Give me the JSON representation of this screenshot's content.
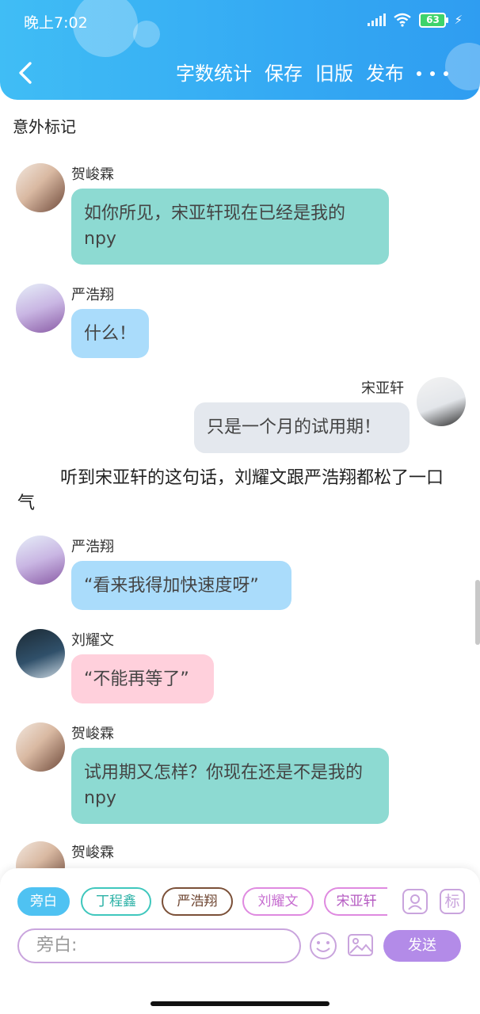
{
  "status": {
    "time": "晚上7:02",
    "battery": "63"
  },
  "nav": {
    "actions": [
      "字数统计",
      "保存",
      "旧版",
      "发布"
    ]
  },
  "doc": {
    "title": "意外标记"
  },
  "messages": [
    {
      "name": "贺峻霖",
      "text": "如你所见，宋亚轩现在已经是我的npy"
    },
    {
      "name": "严浩翔",
      "text": "什么！"
    },
    {
      "name": "宋亚轩",
      "text": "只是一个月的试用期！"
    },
    {
      "name": "严浩翔",
      "text": "“看来我得加快速度呀”"
    },
    {
      "name": "刘耀文",
      "text": "“不能再等了”"
    },
    {
      "name": "贺峻霖",
      "text": "试用期又怎样？你现在还是不是我的npy"
    },
    {
      "name": "贺峻霖",
      "text": ""
    }
  ],
  "narration": "听到宋亚轩的这句话，刘耀文跟严浩翔都松了一口气",
  "composer": {
    "roles": [
      "旁白",
      "丁程鑫",
      "严浩翔",
      "刘耀文",
      "宋亚轩"
    ],
    "mark_label": "标",
    "input_placeholder": "旁白:",
    "send_label": "发送"
  },
  "colors": {
    "header": "#35aaf3",
    "bubble_green": "#8ddad2",
    "bubble_blue": "#aadcfb",
    "bubble_gray": "#e4e8ee",
    "bubble_pink": "#ffd0dc",
    "accent_purple": "#b38be8"
  }
}
